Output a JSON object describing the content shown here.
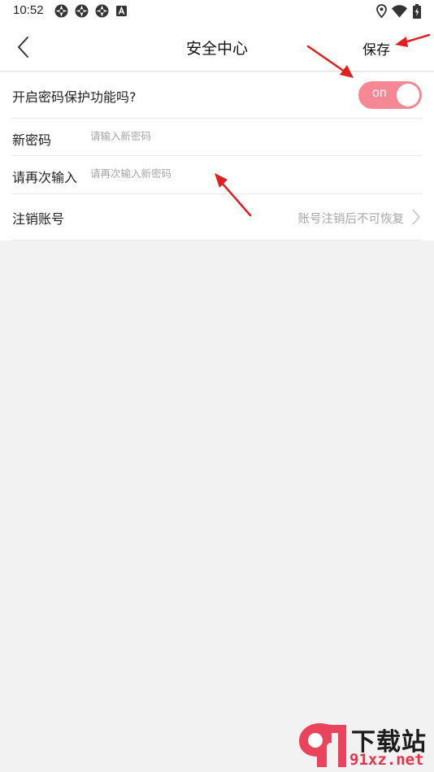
{
  "status_bar": {
    "time": "10:52",
    "icons": [
      "notification-icon",
      "notification-icon",
      "notification-icon",
      "keyboard-a-icon",
      "location-icon",
      "wifi-icon",
      "battery-icon"
    ]
  },
  "header": {
    "title": "安全中心",
    "save_label": "保存"
  },
  "settings": {
    "password_protection": {
      "label": "开启密码保护功能吗?",
      "toggle_text": "on",
      "toggle_on": true,
      "toggle_color": "#f68795"
    },
    "new_password": {
      "label": "新密码",
      "placeholder": "请输入新密码"
    },
    "confirm_password": {
      "label": "请再次输入",
      "placeholder": "请再次输入新密码"
    },
    "deregister": {
      "label": "注销账号",
      "hint": "账号注销后不可恢复"
    }
  },
  "watermark": {
    "logo_text": "下载站",
    "domain_text": "91xz.net"
  },
  "colors": {
    "background": "#f2f2f2",
    "accent_arrow": "#e02020",
    "toggle": "#f68795"
  }
}
